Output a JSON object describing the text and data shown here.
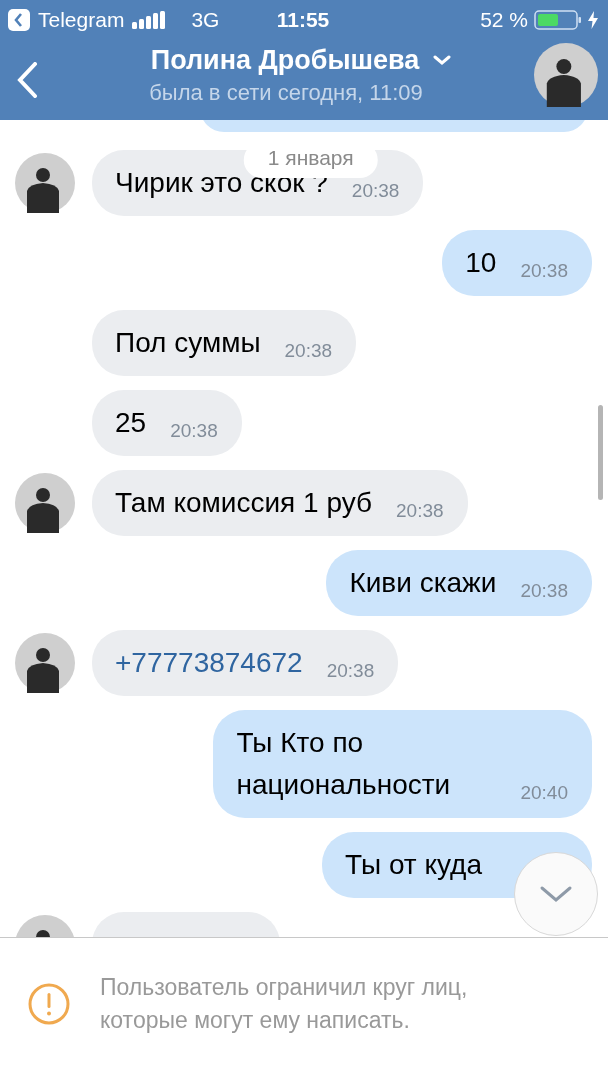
{
  "status_bar": {
    "back_app": "Telegram",
    "network": "3G",
    "time": "11:55",
    "battery": "52 %"
  },
  "header": {
    "title": "Полина Дробышева",
    "subtitle": "была в сети сегодня, 11:09"
  },
  "date_divider": "1 января",
  "messages": [
    {
      "kind": "in",
      "avatar": true,
      "text": "Чирик это скок ?",
      "time": "20:38"
    },
    {
      "kind": "out",
      "text": "10",
      "time": "20:38"
    },
    {
      "kind": "in",
      "avatar": false,
      "text": "Пол суммы",
      "time": "20:38"
    },
    {
      "kind": "in",
      "avatar": false,
      "text": "25",
      "time": "20:38"
    },
    {
      "kind": "in",
      "avatar": true,
      "text": "Там комиссия 1 руб",
      "time": "20:38"
    },
    {
      "kind": "out",
      "text": "Киви скажи",
      "time": "20:38"
    },
    {
      "kind": "in",
      "avatar": true,
      "link": true,
      "text": "+77773874672",
      "time": "20:38"
    },
    {
      "kind": "out",
      "text": "Ты Кто по национальности",
      "time": "20:40"
    },
    {
      "kind": "out",
      "text": "Ты от куда"
    },
    {
      "kind": "in",
      "avatar": true
    }
  ],
  "notice": "Пользователь ограничил круг лиц, которые могут ему написать."
}
